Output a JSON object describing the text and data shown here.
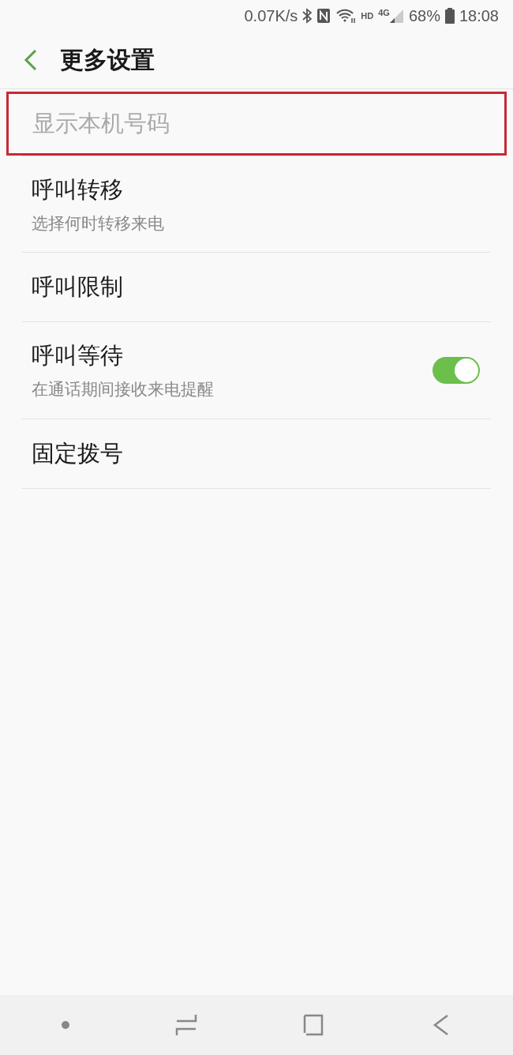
{
  "status_bar": {
    "speed": "0.07K/s",
    "hd": "HD",
    "network": "4G",
    "battery": "68%",
    "time": "18:08"
  },
  "header": {
    "title": "更多设置"
  },
  "items": [
    {
      "kind": "plain",
      "title": "显示本机号码",
      "disabled": true,
      "highlighted": true
    },
    {
      "kind": "plain",
      "title": "呼叫转移",
      "subtitle": "选择何时转移来电",
      "disabled": false,
      "highlighted": false
    },
    {
      "kind": "plain",
      "title": "呼叫限制",
      "disabled": false,
      "highlighted": false
    },
    {
      "kind": "toggle",
      "title": "呼叫等待",
      "subtitle": "在通话期间接收来电提醒",
      "on": true,
      "disabled": false,
      "highlighted": false
    },
    {
      "kind": "plain",
      "title": "固定拨号",
      "disabled": false,
      "highlighted": false
    }
  ]
}
